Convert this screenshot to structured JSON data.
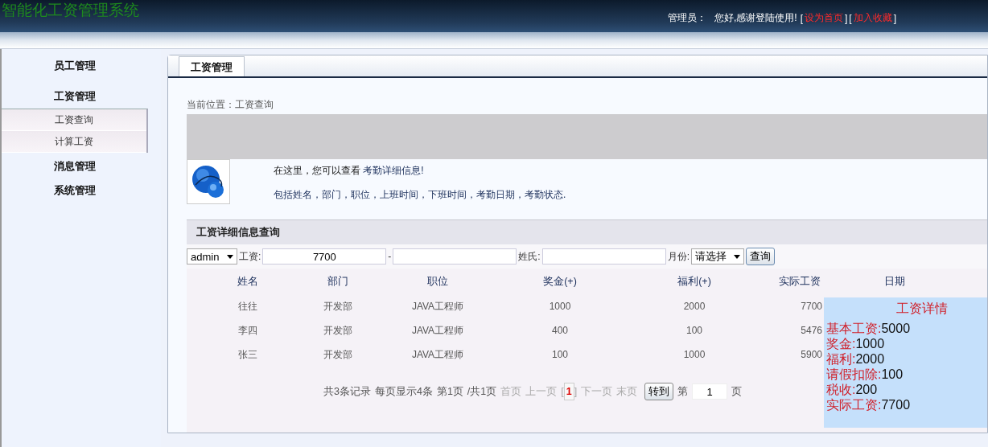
{
  "header": {
    "title": "智能化工资管理系统",
    "greeting_label": "管理员：",
    "greeting": "您好,感谢登陆使用!",
    "links": [
      "设为首页",
      "加入收藏"
    ],
    "brackets": [
      "[",
      "]"
    ]
  },
  "sidebar": {
    "groups": [
      {
        "label": "员工管理"
      },
      {
        "label": "工资管理",
        "items": [
          {
            "label": "工资查询",
            "selected": false
          },
          {
            "label": "计算工资",
            "selected": false
          }
        ]
      },
      {
        "label": "消息管理"
      },
      {
        "label": "系统管理"
      }
    ]
  },
  "tabs": [
    {
      "label": "工资管理",
      "selected": true
    }
  ],
  "breadcrumb": "当前位置：工资查询",
  "intro": {
    "line1": "在这里，您可以查看 **考勤详细信息!**",
    "line2": "包括姓名，部门，职位，上班时间，下班时间，考勤日期，考勤状态."
  },
  "section_title": "工资详细信息查询",
  "filters": {
    "user_select": "admin",
    "salary_label": "工资:",
    "salary_min": "7700",
    "separator": "-",
    "surname_label": "姓氏:",
    "month_label": "月份:",
    "month_select": "请选择",
    "query_button": "查询"
  },
  "table": {
    "columns": [
      "姓名",
      "部门",
      "职位",
      "奖金(+)",
      "福利(+)",
      "实际工资",
      "日期"
    ],
    "rows": [
      [
        "往往",
        "开发部",
        "JAVA工程师",
        "1000",
        "2000",
        "7700"
      ],
      [
        "李四",
        "开发部",
        "JAVA工程师",
        "400",
        "100",
        "5476"
      ],
      [
        "张三",
        "开发部",
        "JAVA工程师",
        "100",
        "1000",
        "5900"
      ]
    ]
  },
  "pagination": {
    "summary": [
      "共3条记录",
      "每页显示4条",
      "第1页",
      "/共1页"
    ],
    "links_before": [
      {
        "label": "首页",
        "disabled": true
      },
      {
        "label": "上一页",
        "disabled": true
      }
    ],
    "brackets": [
      "[",
      "]"
    ],
    "current_page": "1",
    "links_after": [
      {
        "label": "下一页",
        "disabled": true
      },
      {
        "label": "末页",
        "disabled": true
      }
    ],
    "goto_button": "转到",
    "page_prefix": "第",
    "page_value": "1",
    "page_suffix": "页"
  },
  "detail": {
    "title": "工资详情",
    "items": [
      {
        "label": "基本工资:",
        "value": "5000"
      },
      {
        "label": "奖金:",
        "value": "1000"
      },
      {
        "label": "福利:",
        "value": "2000"
      },
      {
        "label": "请假扣除:",
        "value": "100"
      },
      {
        "label": "税收:",
        "value": "200"
      },
      {
        "label": "实际工资:",
        "value": "7700"
      }
    ]
  }
}
